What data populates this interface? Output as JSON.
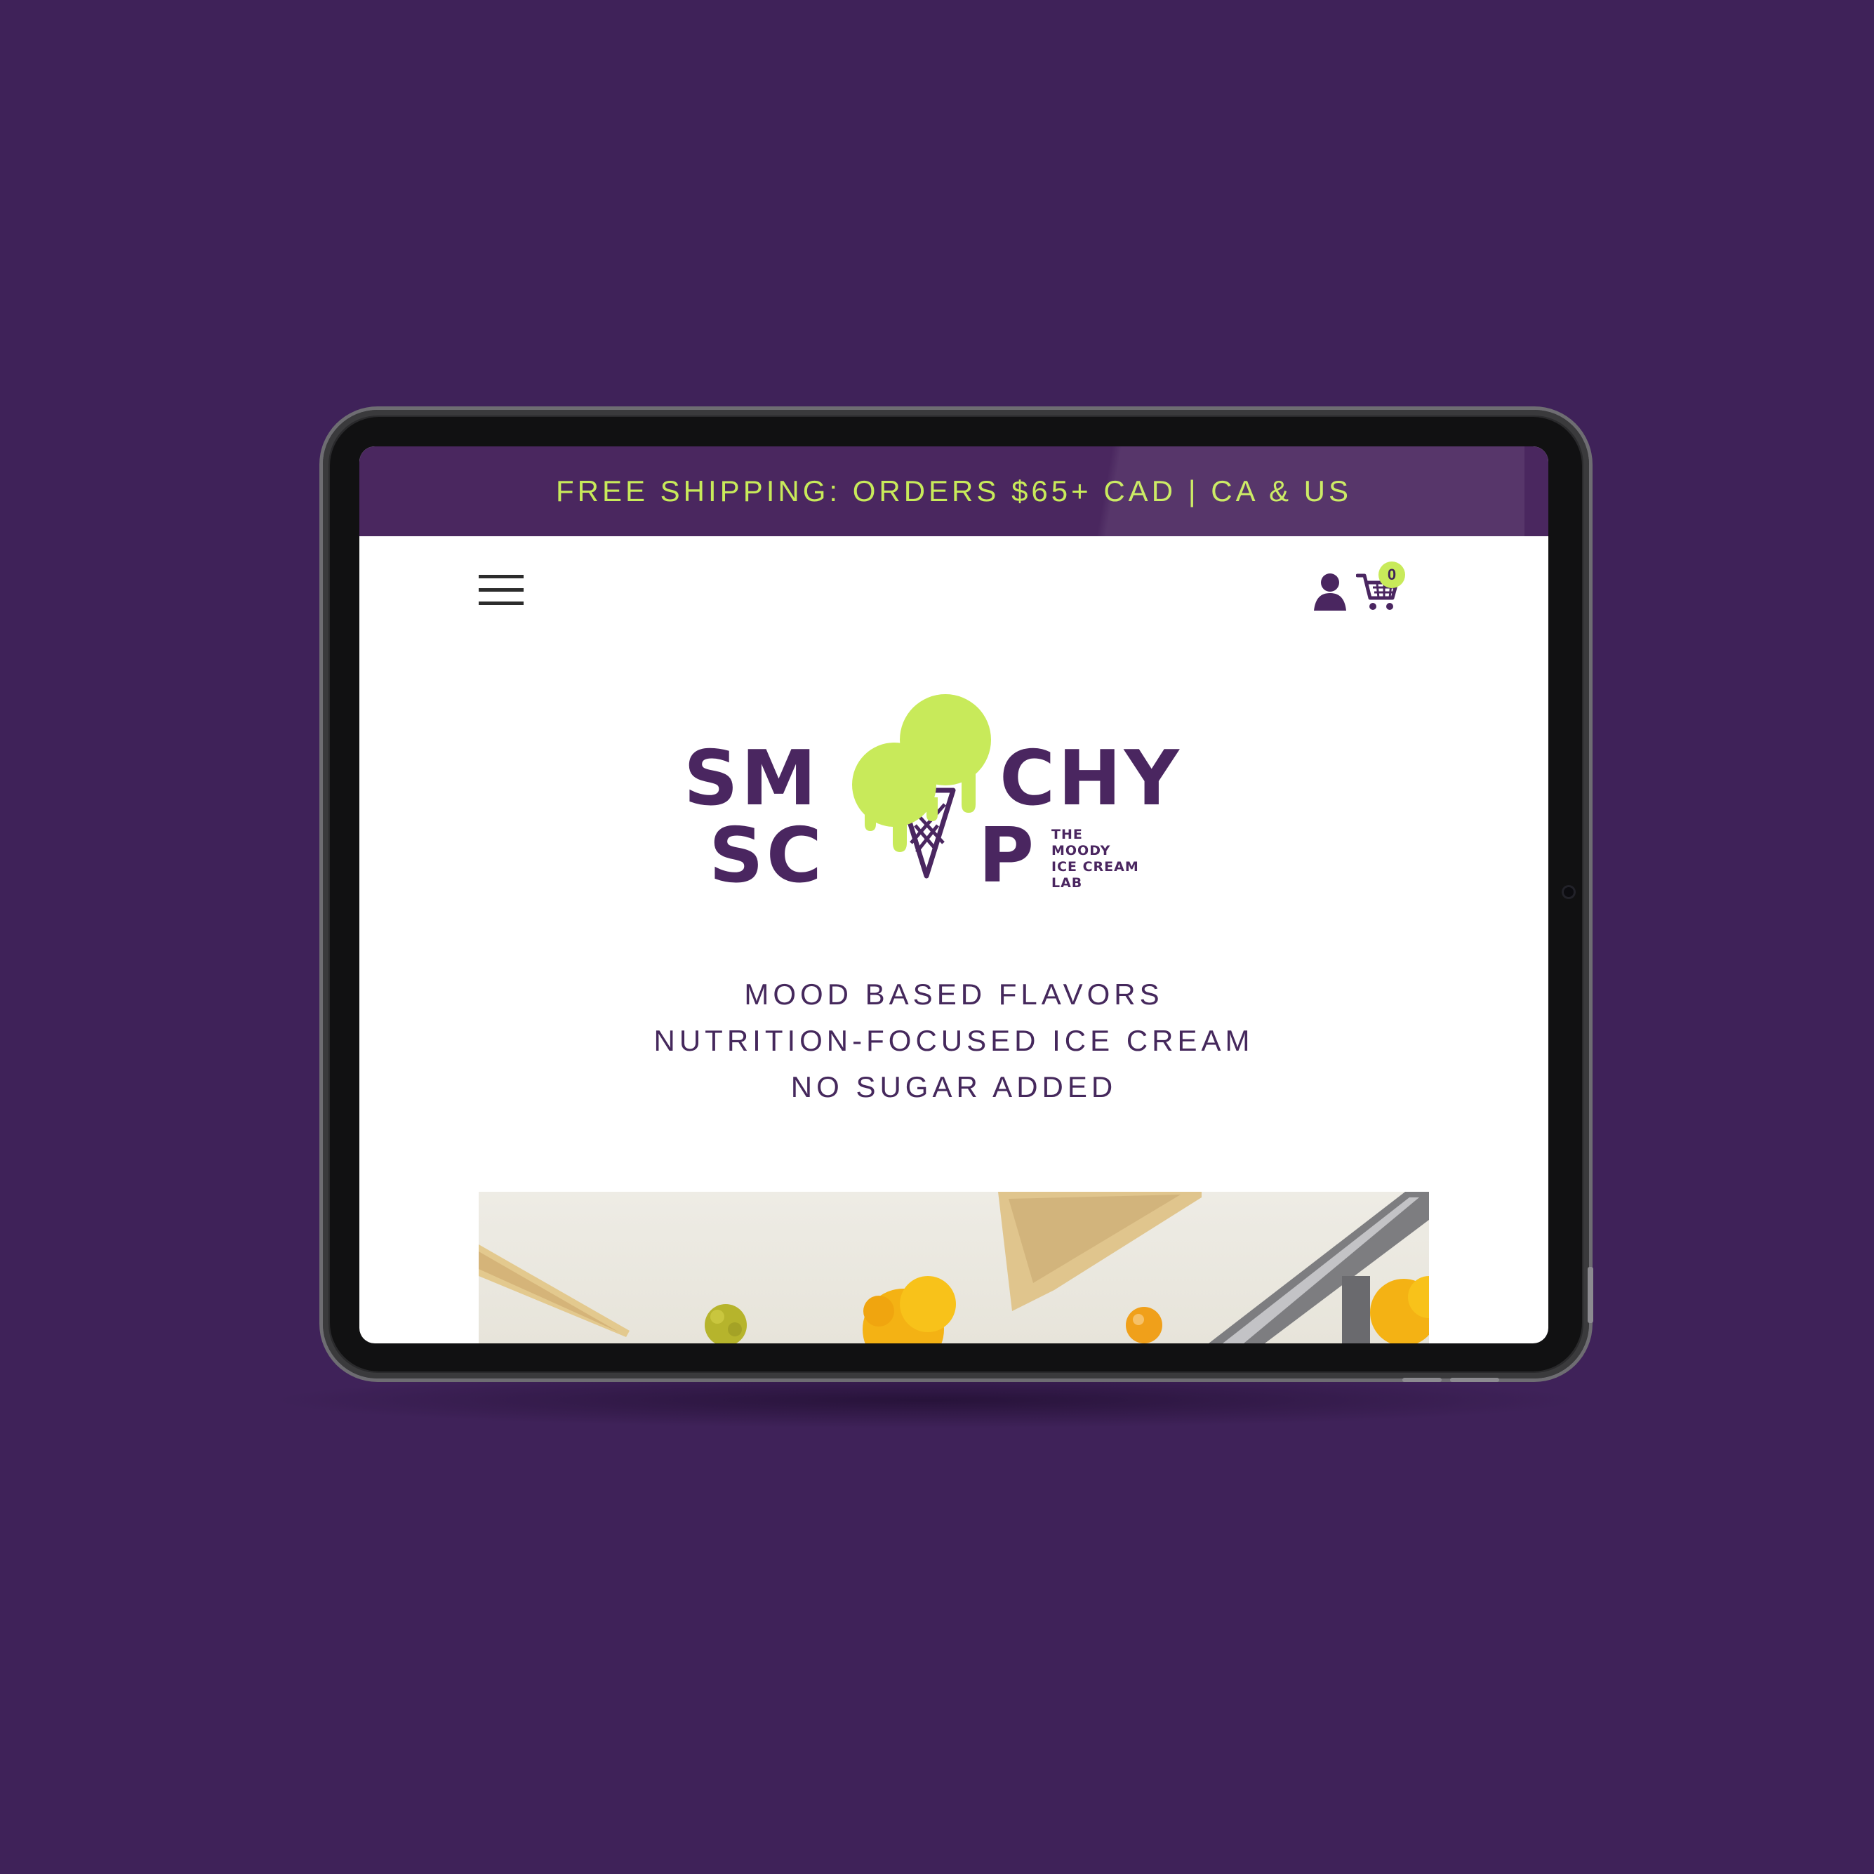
{
  "banner": {
    "text": "FREE SHIPPING: ORDERS $65+ CAD | CA & US"
  },
  "header": {
    "menu_icon": "hamburger-menu-icon",
    "account_icon": "user-account-icon",
    "cart_icon": "shopping-cart-icon",
    "cart_count": "0"
  },
  "logo": {
    "line1_left": "SM",
    "line1_right": "CHY",
    "line2_left": "SC",
    "line2_right": "P",
    "tagline_lines": [
      "THE",
      "MOODY",
      "ICE CREAM",
      "LAB"
    ]
  },
  "hero_text": {
    "line1": "MOOD BASED FLAVORS",
    "line2": "NUTRITION-FOCUSED ICE CREAM",
    "line3": "NO SUGAR ADDED"
  },
  "colors": {
    "page_background": "#3f2259",
    "brand_purple": "#4a2660",
    "accent_lime": "#c8ea5a",
    "device_frame": "#2a2a2c"
  }
}
